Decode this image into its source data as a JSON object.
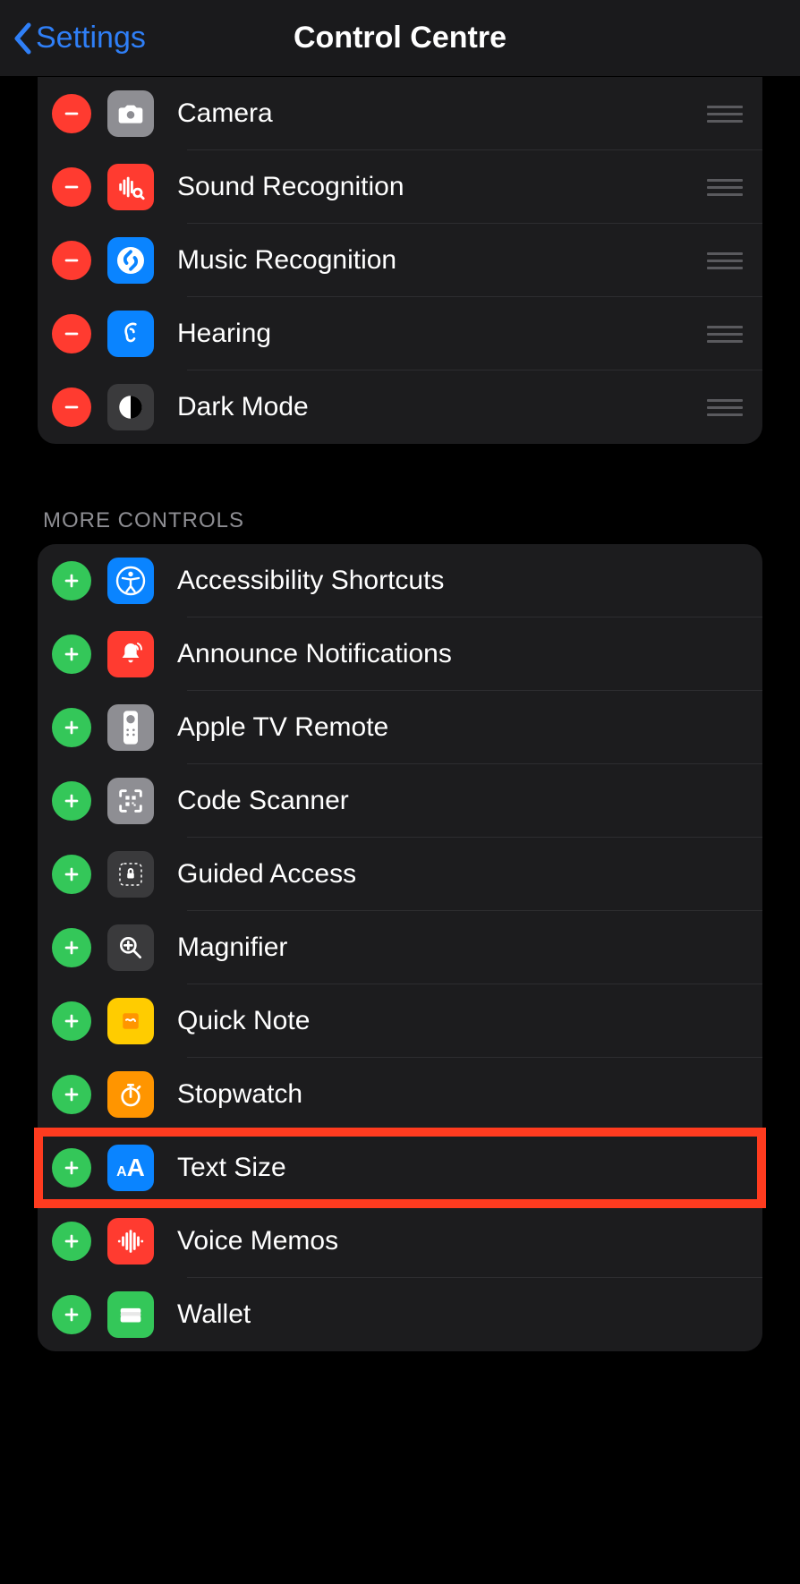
{
  "nav": {
    "back_label": "Settings",
    "title": "Control Centre"
  },
  "included_section": {
    "items": [
      {
        "id": "camera",
        "label": "Camera"
      },
      {
        "id": "sound",
        "label": "Sound Recognition"
      },
      {
        "id": "music",
        "label": "Music Recognition"
      },
      {
        "id": "hearing",
        "label": "Hearing"
      },
      {
        "id": "darkmode",
        "label": "Dark Mode"
      }
    ]
  },
  "more_section": {
    "header": "More Controls",
    "items": [
      {
        "id": "accessibility",
        "label": "Accessibility Shortcuts"
      },
      {
        "id": "announce",
        "label": "Announce Notifications"
      },
      {
        "id": "appletv",
        "label": "Apple TV Remote"
      },
      {
        "id": "codescanner",
        "label": "Code Scanner"
      },
      {
        "id": "guided",
        "label": "Guided Access"
      },
      {
        "id": "magnifier",
        "label": "Magnifier"
      },
      {
        "id": "quicknote",
        "label": "Quick Note"
      },
      {
        "id": "stopwatch",
        "label": "Stopwatch"
      },
      {
        "id": "textsize",
        "label": "Text Size"
      },
      {
        "id": "voicememos",
        "label": "Voice Memos"
      },
      {
        "id": "wallet",
        "label": "Wallet"
      }
    ]
  },
  "highlight_item_id": "textsize"
}
